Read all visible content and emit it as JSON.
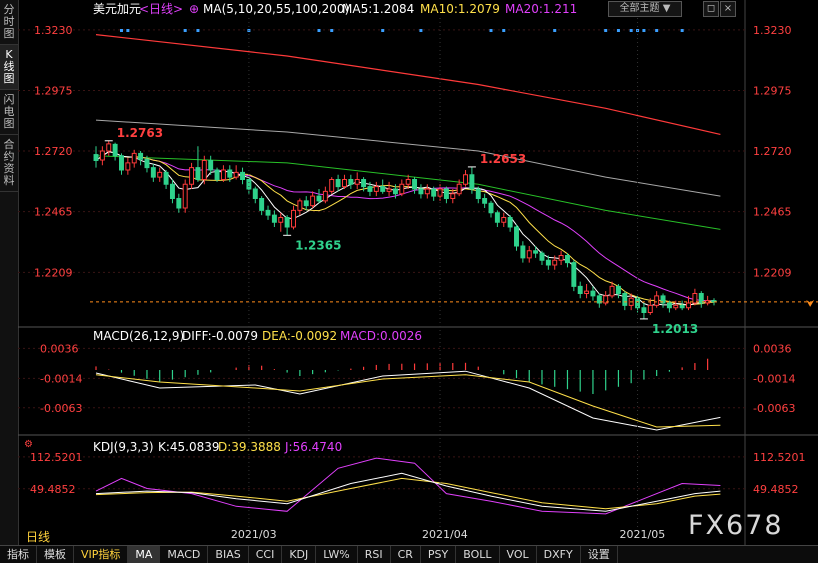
{
  "left_tabs": [
    "分时图",
    "K线图",
    "闪电图",
    "合约资料"
  ],
  "active_left_tab": 1,
  "bottom_tabs": [
    "指标",
    "模板",
    "VIP指标",
    "MA",
    "MACD",
    "BIAS",
    "CCI",
    "KDJ",
    "LW%",
    "RSI",
    "CR",
    "PSY",
    "BOLL",
    "VOL",
    "DXFY",
    "设置"
  ],
  "bottom_tab_active": "VIP指标",
  "bottom_tab_selected": "MA",
  "theme_button": "全部主题",
  "window_buttons": {
    "restore": "◻",
    "close": "×"
  },
  "period_label": "日线",
  "watermark": "FX678",
  "colors": {
    "up": "#ff3b3b",
    "down": "#2fd28c",
    "ma5": "#ffffff",
    "ma10": "#ffe04a",
    "ma20": "#e040fb",
    "ma55": "#28c028",
    "ma100": "#a8a8a8",
    "ma200": "#ff3a3a",
    "last_price": "#ff8c1a",
    "dots": "#3aa0ff"
  },
  "chart_data": {
    "type": "candlestick",
    "symbol": "美元加元",
    "period": "<日线>",
    "ma_legend": {
      "label": "MA(5,10,20,55,100,200)",
      "ma5": "MA5:1.2084",
      "ma10": "MA10:1.2079",
      "ma20": "MA20:1.211"
    },
    "price_ticks": [
      "1.3230",
      "1.2975",
      "1.2720",
      "1.2465",
      "1.2209"
    ],
    "price_ticks_values": [
      1.323,
      1.2975,
      1.272,
      1.2465,
      1.2209
    ],
    "price_range": [
      1.2,
      1.328
    ],
    "annotations": [
      {
        "text": "1.2763",
        "index": 2,
        "value": 1.2763,
        "type": "high"
      },
      {
        "text": "1.2365",
        "index": 30,
        "value": 1.2365,
        "type": "low"
      },
      {
        "text": "1.2653",
        "index": 59,
        "value": 1.2653,
        "type": "high"
      },
      {
        "text": "1.2013",
        "index": 86,
        "value": 1.2013,
        "type": "low"
      }
    ],
    "last_price": 1.2085,
    "candles": [
      [
        1.2705,
        1.268,
        1.274,
        1.265
      ],
      [
        1.2682,
        1.272,
        1.274,
        1.266
      ],
      [
        1.272,
        1.275,
        1.2763,
        1.27
      ],
      [
        1.2748,
        1.27,
        1.2755,
        1.268
      ],
      [
        1.27,
        1.264,
        1.271,
        1.262
      ],
      [
        1.264,
        1.267,
        1.269,
        1.262
      ],
      [
        1.267,
        1.271,
        1.2725,
        1.265
      ],
      [
        1.271,
        1.2685,
        1.272,
        1.266
      ],
      [
        1.2685,
        1.265,
        1.27,
        1.263
      ],
      [
        1.265,
        1.261,
        1.2665,
        1.259
      ],
      [
        1.261,
        1.263,
        1.265,
        1.259
      ],
      [
        1.263,
        1.258,
        1.264,
        1.256
      ],
      [
        1.258,
        1.252,
        1.26,
        1.25
      ],
      [
        1.252,
        1.248,
        1.254,
        1.246
      ],
      [
        1.248,
        1.258,
        1.26,
        1.246
      ],
      [
        1.258,
        1.265,
        1.267,
        1.256
      ],
      [
        1.265,
        1.26,
        1.274,
        1.259
      ],
      [
        1.26,
        1.268,
        1.27,
        1.258
      ],
      [
        1.268,
        1.264,
        1.27,
        1.262
      ],
      [
        1.264,
        1.26,
        1.265,
        1.259
      ],
      [
        1.26,
        1.264,
        1.266,
        1.259
      ],
      [
        1.264,
        1.261,
        1.266,
        1.259
      ],
      [
        1.261,
        1.263,
        1.266,
        1.26
      ],
      [
        1.263,
        1.26,
        1.265,
        1.258
      ],
      [
        1.26,
        1.256,
        1.261,
        1.254
      ],
      [
        1.256,
        1.252,
        1.257,
        1.25
      ],
      [
        1.252,
        1.247,
        1.253,
        1.245
      ],
      [
        1.247,
        1.245,
        1.249,
        1.243
      ],
      [
        1.245,
        1.242,
        1.247,
        1.24
      ],
      [
        1.242,
        1.244,
        1.246,
        1.238
      ],
      [
        1.244,
        1.24,
        1.245,
        1.2365
      ],
      [
        1.24,
        1.247,
        1.249,
        1.239
      ],
      [
        1.247,
        1.251,
        1.252,
        1.245
      ],
      [
        1.251,
        1.249,
        1.253,
        1.247
      ],
      [
        1.249,
        1.253,
        1.255,
        1.248
      ],
      [
        1.253,
        1.251,
        1.256,
        1.25
      ],
      [
        1.251,
        1.255,
        1.257,
        1.25
      ],
      [
        1.255,
        1.26,
        1.261,
        1.254
      ],
      [
        1.26,
        1.257,
        1.262,
        1.255
      ],
      [
        1.257,
        1.26,
        1.262,
        1.256
      ],
      [
        1.26,
        1.258,
        1.262,
        1.256
      ],
      [
        1.258,
        1.26,
        1.263,
        1.256
      ],
      [
        1.26,
        1.257,
        1.261,
        1.255
      ],
      [
        1.257,
        1.255,
        1.259,
        1.253
      ],
      [
        1.255,
        1.257,
        1.259,
        1.253
      ],
      [
        1.257,
        1.255,
        1.26,
        1.254
      ],
      [
        1.255,
        1.256,
        1.259,
        1.253
      ],
      [
        1.256,
        1.254,
        1.258,
        1.252
      ],
      [
        1.254,
        1.258,
        1.26,
        1.253
      ],
      [
        1.258,
        1.26,
        1.262,
        1.256
      ],
      [
        1.26,
        1.256,
        1.261,
        1.254
      ],
      [
        1.256,
        1.254,
        1.258,
        1.252
      ],
      [
        1.254,
        1.256,
        1.258,
        1.252
      ],
      [
        1.256,
        1.253,
        1.257,
        1.251
      ],
      [
        1.253,
        1.256,
        1.258,
        1.251
      ],
      [
        1.256,
        1.252,
        1.257,
        1.25
      ],
      [
        1.252,
        1.254,
        1.256,
        1.25
      ],
      [
        1.254,
        1.258,
        1.26,
        1.253
      ],
      [
        1.258,
        1.262,
        1.264,
        1.257
      ],
      [
        1.262,
        1.256,
        1.2653,
        1.254
      ],
      [
        1.256,
        1.252,
        1.257,
        1.25
      ],
      [
        1.252,
        1.25,
        1.254,
        1.248
      ],
      [
        1.25,
        1.246,
        1.251,
        1.244
      ],
      [
        1.246,
        1.242,
        1.247,
        1.24
      ],
      [
        1.242,
        1.244,
        1.246,
        1.24
      ],
      [
        1.244,
        1.24,
        1.245,
        1.238
      ],
      [
        1.24,
        1.232,
        1.241,
        1.23
      ],
      [
        1.232,
        1.227,
        1.234,
        1.225
      ],
      [
        1.227,
        1.23,
        1.232,
        1.225
      ],
      [
        1.23,
        1.229,
        1.232,
        1.227
      ],
      [
        1.229,
        1.226,
        1.23,
        1.224
      ],
      [
        1.226,
        1.224,
        1.228,
        1.222
      ],
      [
        1.224,
        1.226,
        1.228,
        1.222
      ],
      [
        1.226,
        1.228,
        1.23,
        1.224
      ],
      [
        1.228,
        1.225,
        1.229,
        1.223
      ],
      [
        1.225,
        1.215,
        1.226,
        1.213
      ],
      [
        1.215,
        1.212,
        1.217,
        1.21
      ],
      [
        1.212,
        1.213,
        1.216,
        1.21
      ],
      [
        1.213,
        1.211,
        1.215,
        1.209
      ],
      [
        1.211,
        1.208,
        1.212,
        1.206
      ],
      [
        1.208,
        1.211,
        1.213,
        1.207
      ],
      [
        1.211,
        1.215,
        1.217,
        1.21
      ],
      [
        1.215,
        1.212,
        1.216,
        1.21
      ],
      [
        1.212,
        1.207,
        1.213,
        1.205
      ],
      [
        1.207,
        1.21,
        1.212,
        1.205
      ],
      [
        1.21,
        1.206,
        1.211,
        1.204
      ],
      [
        1.206,
        1.204,
        1.208,
        1.2013
      ],
      [
        1.204,
        1.207,
        1.21,
        1.203
      ],
      [
        1.207,
        1.211,
        1.213,
        1.206
      ],
      [
        1.211,
        1.208,
        1.212,
        1.206
      ],
      [
        1.208,
        1.206,
        1.209,
        1.204
      ],
      [
        1.206,
        1.207,
        1.209,
        1.205
      ],
      [
        1.207,
        1.206,
        1.209,
        1.205
      ],
      [
        1.206,
        1.208,
        1.211,
        1.205
      ],
      [
        1.208,
        1.212,
        1.214,
        1.207
      ],
      [
        1.212,
        1.208,
        1.213,
        1.206
      ],
      [
        1.208,
        1.209,
        1.211,
        1.207
      ],
      [
        1.209,
        1.2085,
        1.21,
        1.207
      ]
    ],
    "ma_long": {
      "ma55": [
        [
          0,
          1.27
        ],
        [
          30,
          1.267
        ],
        [
          60,
          1.258
        ],
        [
          80,
          1.247
        ],
        [
          98,
          1.239
        ]
      ],
      "ma100": [
        [
          0,
          1.285
        ],
        [
          30,
          1.28
        ],
        [
          60,
          1.272
        ],
        [
          80,
          1.261
        ],
        [
          98,
          1.253
        ]
      ],
      "ma200": [
        [
          0,
          1.321
        ],
        [
          30,
          1.312
        ],
        [
          60,
          1.3
        ],
        [
          80,
          1.29
        ],
        [
          98,
          1.279
        ]
      ]
    },
    "dots": [
      4,
      5,
      14,
      16,
      24,
      35,
      37,
      45,
      51,
      62,
      64,
      72,
      80,
      82,
      84,
      85,
      86,
      88,
      92
    ],
    "macd": {
      "label": "MACD(26,12,9)",
      "diff_label": "DIFF:-0.0079",
      "dea_label": "DEA:-0.0092",
      "macd_label": "MACD:0.0026",
      "ticks": [
        "0.0036",
        "-0.0014",
        "-0.0063"
      ],
      "ticks_values": [
        0.0036,
        -0.0014,
        -0.0063
      ],
      "range": [
        -0.01,
        0.005
      ],
      "diff": [
        [
          0,
          -0.0005
        ],
        [
          10,
          -0.003
        ],
        [
          25,
          -0.0025
        ],
        [
          32,
          -0.004
        ],
        [
          45,
          -0.001
        ],
        [
          58,
          -0.0002
        ],
        [
          68,
          -0.003
        ],
        [
          78,
          -0.008
        ],
        [
          88,
          -0.01
        ],
        [
          98,
          -0.0079
        ]
      ],
      "dea": [
        [
          0,
          -0.0008
        ],
        [
          10,
          -0.002
        ],
        [
          25,
          -0.003
        ],
        [
          32,
          -0.0035
        ],
        [
          45,
          -0.0015
        ],
        [
          58,
          -0.0008
        ],
        [
          68,
          -0.002
        ],
        [
          78,
          -0.006
        ],
        [
          88,
          -0.0095
        ],
        [
          98,
          -0.0092
        ]
      ]
    },
    "kdj": {
      "label": "KDJ(9,3,3)",
      "k_label": "K:45.0839",
      "d_label": "D:39.3888",
      "j_label": "J:56.4740",
      "ticks": [
        "112.5201",
        "49.4852"
      ],
      "ticks_values": [
        112.5201,
        49.4852
      ],
      "range": [
        -20,
        130
      ],
      "k": [
        [
          0,
          40
        ],
        [
          8,
          45
        ],
        [
          15,
          42
        ],
        [
          22,
          30
        ],
        [
          30,
          20
        ],
        [
          40,
          60
        ],
        [
          48,
          80
        ],
        [
          55,
          55
        ],
        [
          62,
          35
        ],
        [
          70,
          15
        ],
        [
          80,
          5
        ],
        [
          88,
          25
        ],
        [
          94,
          40
        ],
        [
          98,
          45
        ]
      ],
      "d": [
        [
          0,
          38
        ],
        [
          8,
          42
        ],
        [
          15,
          43
        ],
        [
          22,
          35
        ],
        [
          30,
          25
        ],
        [
          40,
          50
        ],
        [
          48,
          70
        ],
        [
          55,
          60
        ],
        [
          62,
          42
        ],
        [
          70,
          22
        ],
        [
          80,
          10
        ],
        [
          88,
          20
        ],
        [
          94,
          35
        ],
        [
          98,
          39
        ]
      ],
      "j": [
        [
          0,
          45
        ],
        [
          4,
          70
        ],
        [
          8,
          50
        ],
        [
          15,
          40
        ],
        [
          22,
          15
        ],
        [
          30,
          5
        ],
        [
          38,
          90
        ],
        [
          44,
          110
        ],
        [
          50,
          100
        ],
        [
          55,
          40
        ],
        [
          62,
          25
        ],
        [
          70,
          5
        ],
        [
          80,
          0
        ],
        [
          86,
          30
        ],
        [
          92,
          60
        ],
        [
          98,
          56
        ]
      ]
    },
    "date_labels": [
      {
        "text": "2021/03",
        "index": 24
      },
      {
        "text": "2021/04",
        "index": 54
      },
      {
        "text": "2021/05",
        "index": 85
      }
    ]
  }
}
